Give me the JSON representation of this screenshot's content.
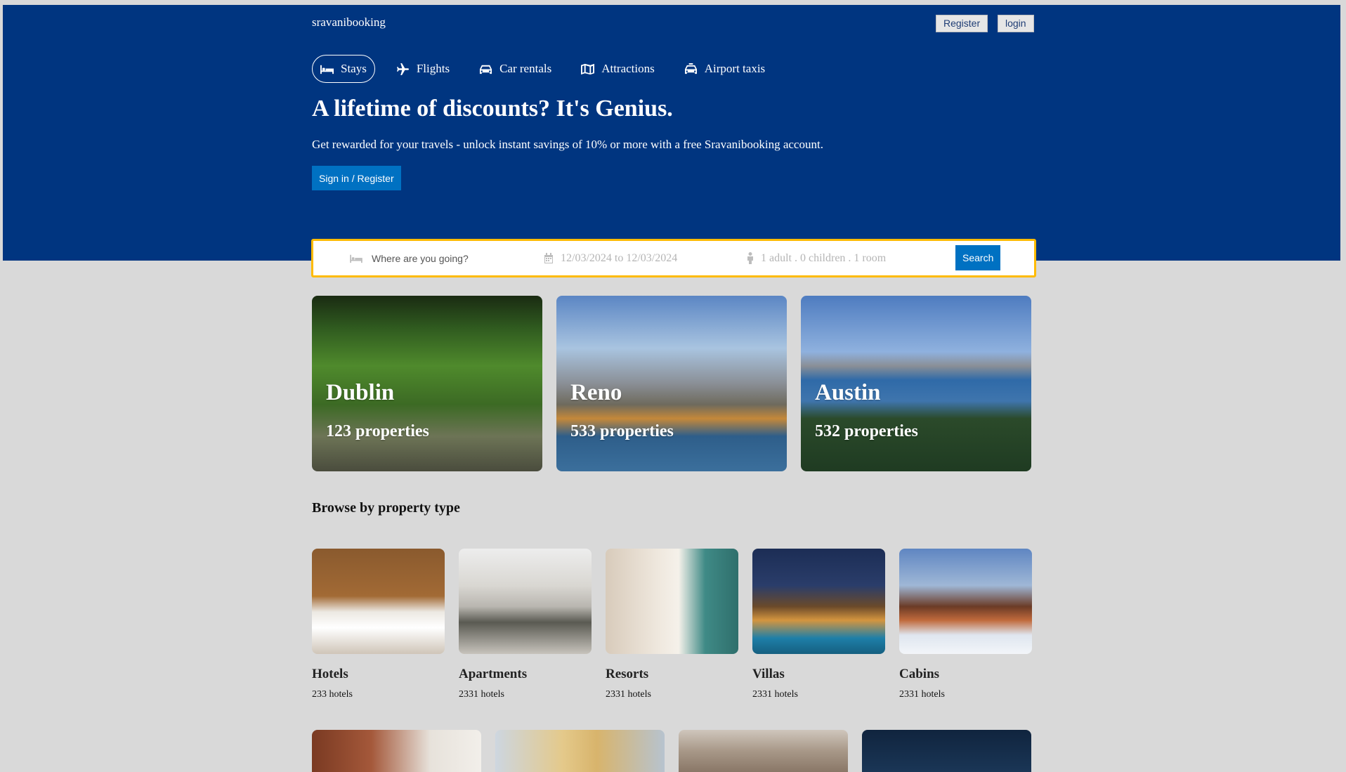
{
  "header": {
    "brand": "sravanibooking",
    "register_label": "Register",
    "login_label": "login"
  },
  "nav": {
    "items": [
      {
        "label": "Stays",
        "icon": "bed-icon",
        "active": true
      },
      {
        "label": "Flights",
        "icon": "plane-icon"
      },
      {
        "label": "Car rentals",
        "icon": "car-icon"
      },
      {
        "label": "Attractions",
        "icon": "map-icon"
      },
      {
        "label": "Airport taxis",
        "icon": "taxi-icon"
      }
    ]
  },
  "hero": {
    "title": "A lifetime of discounts? It's Genius.",
    "subtitle": "Get rewarded for your travels - unlock instant savings of 10% or more with a free Sravanibooking account.",
    "signin_label": "Sign in / Register"
  },
  "search": {
    "destination_placeholder": "Where are you going?",
    "dates": "12/03/2024 to 12/03/2024",
    "guests": "1 adult . 0 children . 1 room",
    "button_label": "Search"
  },
  "featured": [
    {
      "city": "Dublin",
      "properties": "123 properties"
    },
    {
      "city": "Reno",
      "properties": "533 properties"
    },
    {
      "city": "Austin",
      "properties": "532 properties"
    }
  ],
  "property_types": {
    "title": "Browse by property type",
    "items": [
      {
        "name": "Hotels",
        "count": "233 hotels"
      },
      {
        "name": "Apartments",
        "count": "2331 hotels"
      },
      {
        "name": "Resorts",
        "count": "2331 hotels"
      },
      {
        "name": "Villas",
        "count": "2331 hotels"
      },
      {
        "name": "Cabins",
        "count": "2331 hotels"
      }
    ]
  },
  "colors": {
    "hero_bg": "#003580",
    "accent_button": "#0071c2",
    "search_border": "#febb02",
    "page_bg": "#d9d9d9"
  }
}
